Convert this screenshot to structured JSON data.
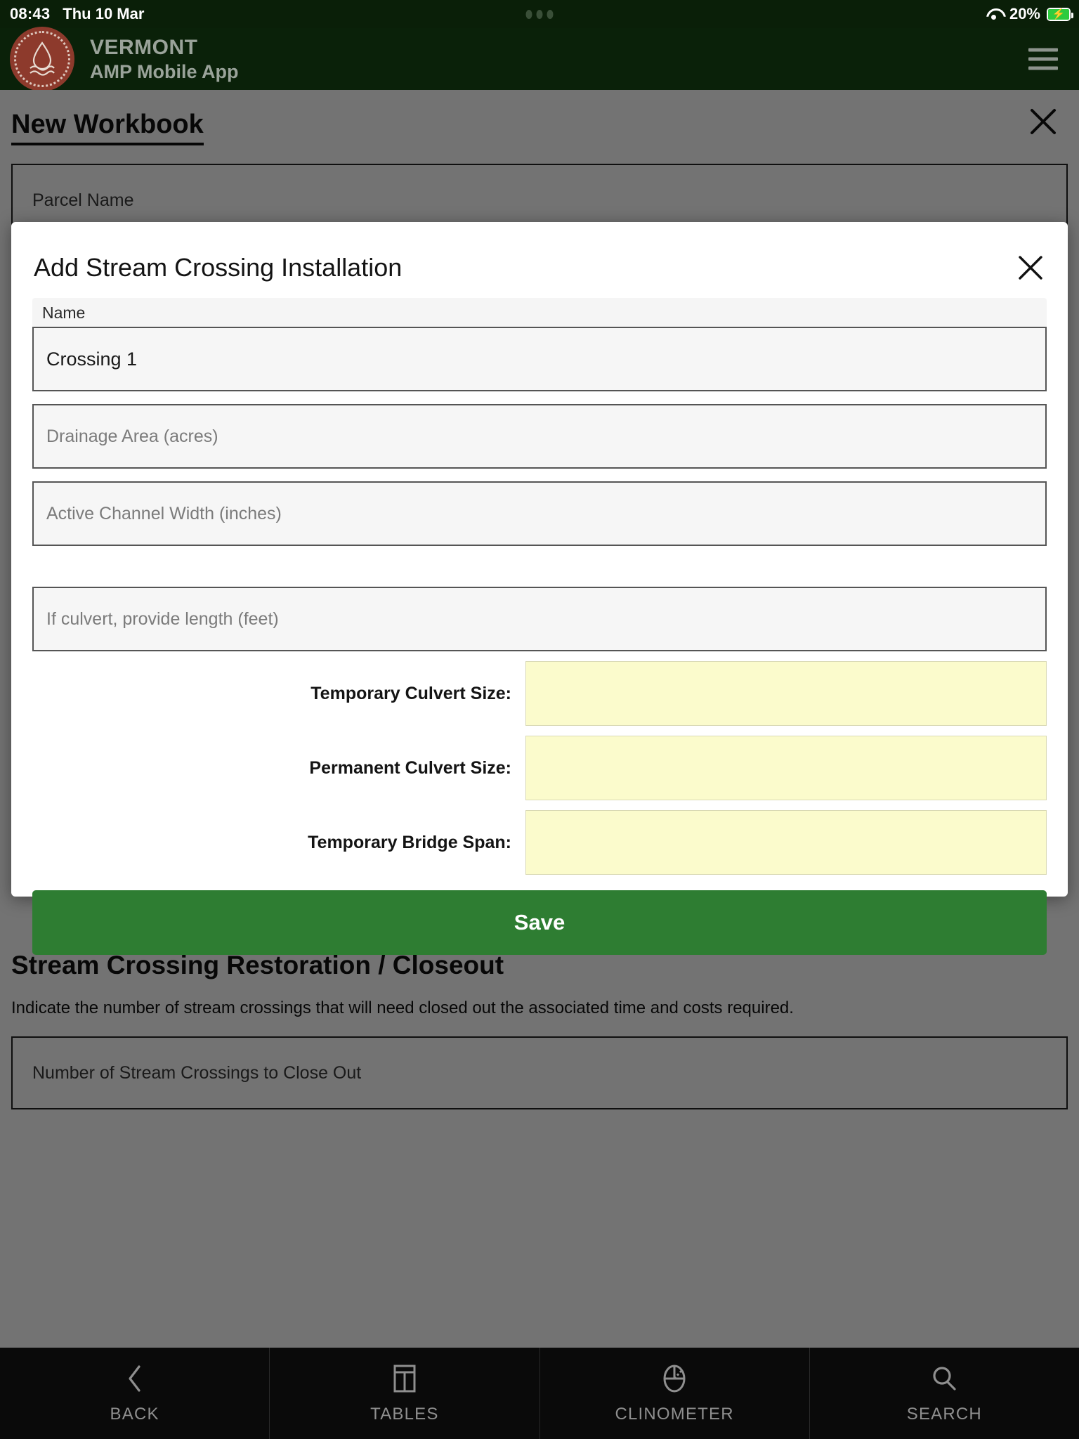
{
  "status_bar": {
    "time": "08:43",
    "date": "Thu 10 Mar",
    "battery_percent": "20%",
    "wifi_icon": "wifi-icon",
    "battery_icon": "battery-charging-icon",
    "recording_dots": "three-dots-icon"
  },
  "app_header": {
    "brand_line1": "VERMONT",
    "brand_line2": "AMP Mobile App",
    "logo_icon": "water-droplet-seal-logo",
    "menu_icon": "hamburger-menu-icon",
    "background_color": "#0a2109"
  },
  "background_page": {
    "title": "New Workbook",
    "close_icon": "close-icon",
    "parcel_name_placeholder": "Parcel Name",
    "section_heading": "Stream Crossing Restoration / Closeout",
    "section_description": "Indicate the number of stream crossings that will need closed out the associated time and costs required.",
    "closeout_placeholder": "Number of Stream Crossings to Close Out"
  },
  "modal": {
    "title": "Add Stream Crossing Installation",
    "close_icon": "close-icon",
    "name_label": "Name",
    "name_value": "Crossing 1",
    "fields": [
      {
        "placeholder": "Drainage Area (acres)",
        "value": ""
      },
      {
        "placeholder": "Active Channel Width (inches)",
        "value": ""
      },
      {
        "placeholder": "If culvert, provide length (feet)",
        "value": ""
      }
    ],
    "highlight_rows": [
      {
        "label": "Temporary Culvert Size:",
        "value": ""
      },
      {
        "label": "Permanent Culvert Size:",
        "value": ""
      },
      {
        "label": "Temporary Bridge Span:",
        "value": ""
      }
    ],
    "highlight_color": "#fbfbcc",
    "save_label": "Save",
    "save_color": "#2e7d32"
  },
  "tab_bar": {
    "tabs": [
      {
        "label": "BACK",
        "icon": "chevron-left-icon"
      },
      {
        "label": "TABLES",
        "icon": "table-icon"
      },
      {
        "label": "CLINOMETER",
        "icon": "clinometer-icon"
      },
      {
        "label": "SEARCH",
        "icon": "search-icon"
      }
    ]
  }
}
